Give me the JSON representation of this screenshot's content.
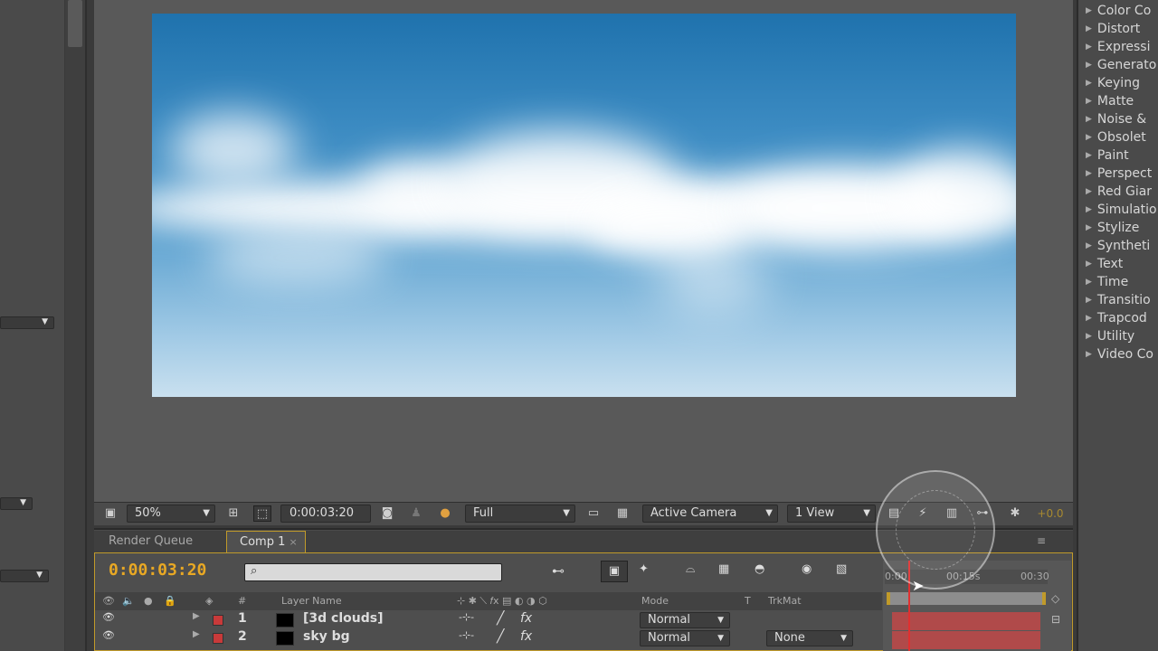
{
  "viewer": {
    "zoom": "50%",
    "timecode": "0:00:03:20",
    "resolution": "Full",
    "camera": "Active Camera",
    "views": "1 View",
    "exposure": "+0.0"
  },
  "timeline": {
    "tabs": [
      {
        "label": "Render Queue"
      },
      {
        "label": "Comp 1",
        "close": "×"
      }
    ],
    "timecode": "0:00:03:20",
    "columns": {
      "number": "#",
      "layer_name": "Layer Name",
      "mode": "Mode",
      "t": "T",
      "trkmat": "TrkMat"
    },
    "ruler": {
      "start": "0:00",
      "mid": "00:15s",
      "end": "00:30"
    },
    "layers": [
      {
        "index": "1",
        "name": "[3d clouds]",
        "mode": "Normal",
        "trkmat": ""
      },
      {
        "index": "2",
        "name": "sky bg",
        "mode": "Normal",
        "trkmat": "None"
      }
    ],
    "colors": {
      "label_red": "#c83a3a",
      "timecode": "#e8a824",
      "border": "#c09a2a"
    }
  },
  "effects": [
    "Color Co",
    "Distort",
    "Expressi",
    "Generato",
    "Keying",
    "Matte",
    "Noise &",
    "Obsolet",
    "Paint",
    "Perspect",
    "Red Giar",
    "Simulatio",
    "Stylize",
    "Syntheti",
    "Text",
    "Time",
    "Transitio",
    "Trapcod",
    "Utility",
    "Video Co"
  ],
  "icons": [
    "toggle-transparency-icon",
    "region-of-interest-icon",
    "snapshot-icon",
    "channel-icon",
    "grid-icon",
    "layers-icon",
    "fast-preview-icon",
    "flowchart-icon",
    "motion-blur-icon",
    "brainstorm-icon",
    "search-icon",
    "eye-icon",
    "audio-icon",
    "solo-icon",
    "lock-icon",
    "label-icon",
    "fx-icon"
  ]
}
